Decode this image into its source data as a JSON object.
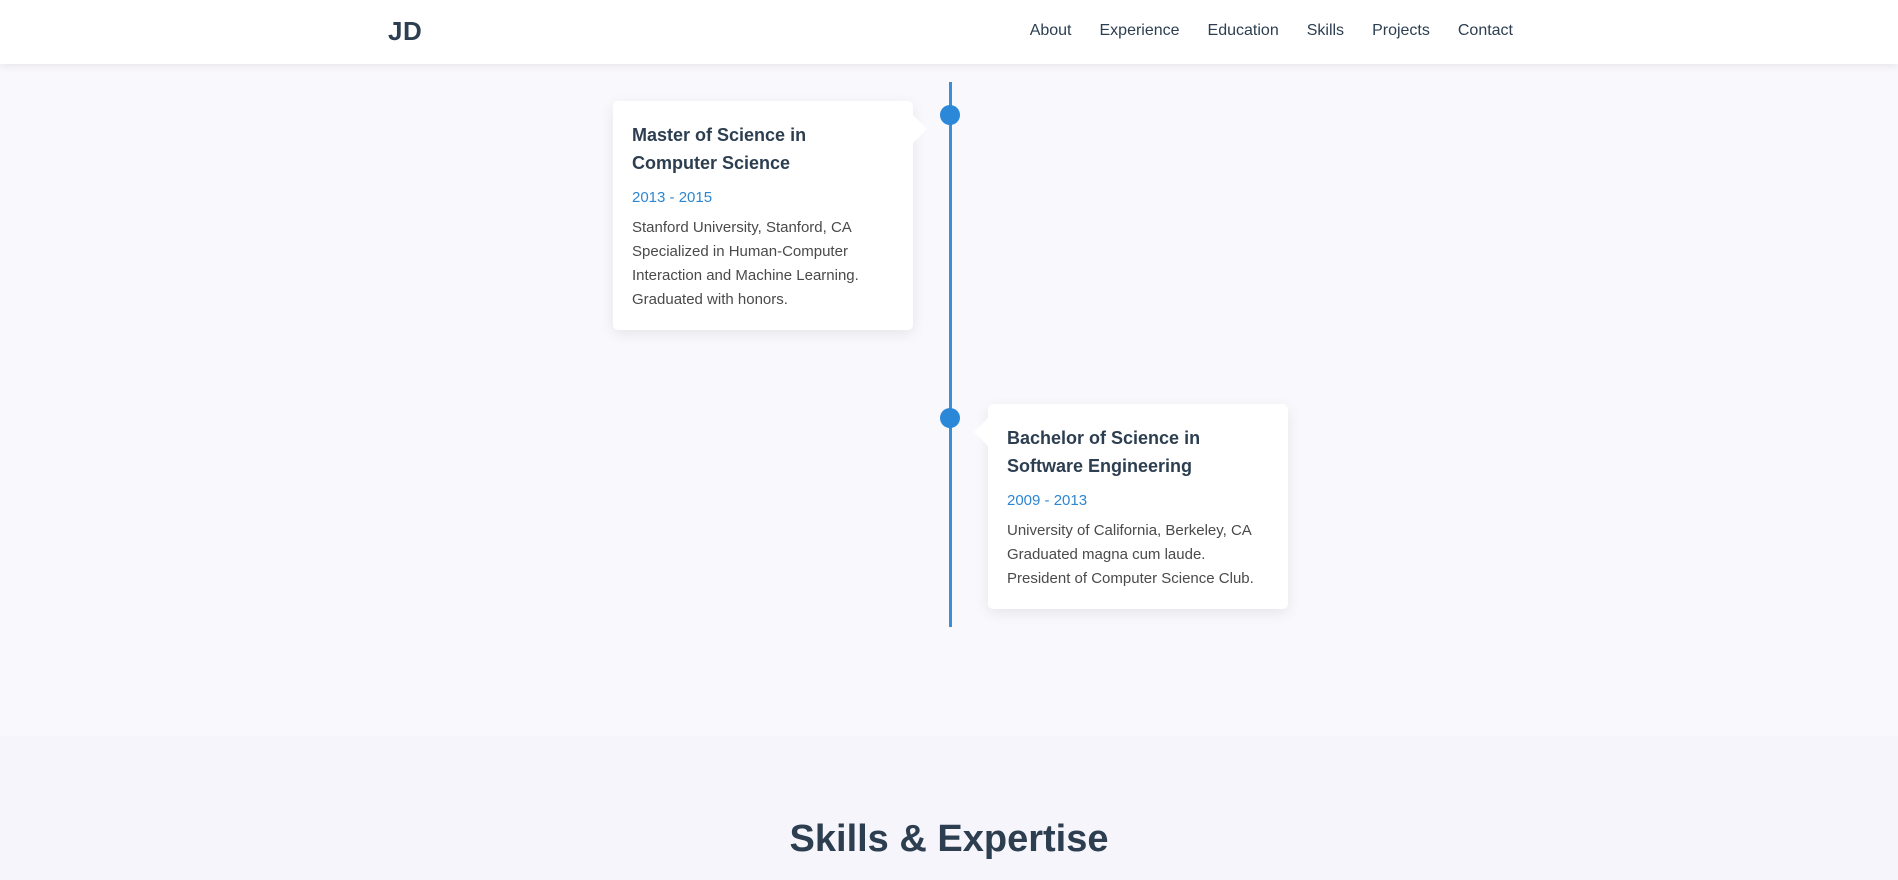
{
  "header": {
    "logo": "JD",
    "nav": [
      "About",
      "Experience",
      "Education",
      "Skills",
      "Projects",
      "Contact"
    ]
  },
  "education": [
    {
      "title": "Master of Science in Computer Science",
      "date": "2013 - 2015",
      "location": "Stanford University, Stanford, CA",
      "description": "Specialized in Human-Computer Interaction and Machine Learning. Graduated with honors."
    },
    {
      "title": "Bachelor of Science in Software Engineering",
      "date": "2009 - 2013",
      "location": "University of California, Berkeley, CA",
      "description": "Graduated magna cum laude. President of Computer Science Club."
    }
  ],
  "skills": {
    "title": "Skills & Expertise"
  },
  "colors": {
    "accent": "#2b88d8",
    "text": "#2c3e50",
    "background": "#f9f8fc"
  }
}
